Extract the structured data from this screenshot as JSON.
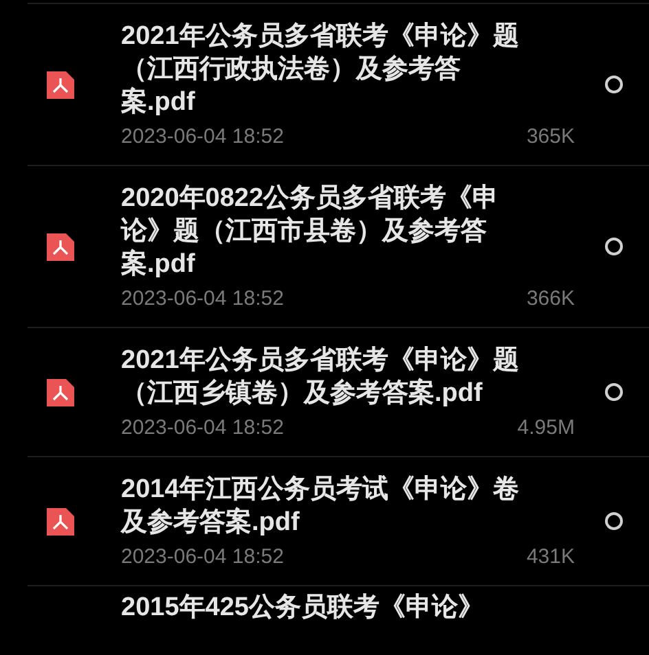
{
  "files": [
    {
      "title": "2021年公务员多省联考《申论》题（江西行政执法卷）及参考答案.pdf",
      "date": "2023-06-04 18:52",
      "size": "365K",
      "selected": false
    },
    {
      "title": "2020年0822公务员多省联考《申论》题（江西市县卷）及参考答案.pdf",
      "date": "2023-06-04 18:52",
      "size": "366K",
      "selected": false
    },
    {
      "title": "2021年公务员多省联考《申论》题（江西乡镇卷）及参考答案.pdf",
      "date": "2023-06-04 18:52",
      "size": "4.95M",
      "selected": false
    },
    {
      "title": "2014年江西公务员考试《申论》卷及参考答案.pdf",
      "date": "2023-06-04 18:52",
      "size": "431K",
      "selected": false
    },
    {
      "title": "2015年425公务员联考《申论》"
    }
  ]
}
